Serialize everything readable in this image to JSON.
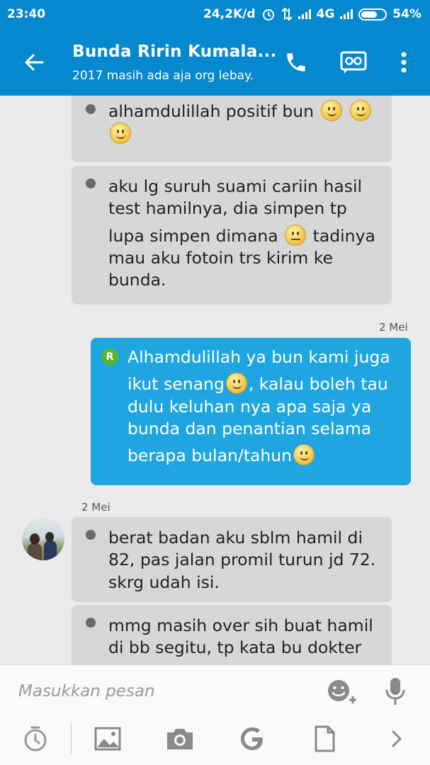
{
  "status_bar": {
    "time": "23:40",
    "speed": "24,2K/d",
    "network": "4G",
    "battery": "54%"
  },
  "header": {
    "title": "Bunda Ririn Kumala...",
    "subtitle": "2017 masih ada aja org lebay.",
    "icons": [
      "back-arrow-icon",
      "phone-icon",
      "video-call-icon",
      "more-vert-icon"
    ]
  },
  "messages": [
    {
      "direction": "in",
      "lines": [
        "alhamdulillah positif bun",
        ""
      ]
    },
    {
      "direction": "in",
      "lines": [
        "aku lg suruh suami cariin hasil",
        "test hamilnya, dia simpen tp",
        "lupa simpen dimana",
        "tadinya",
        "mau aku fotoin trs kirim ke",
        "bunda."
      ]
    },
    {
      "direction": "out",
      "date": "2 Mei",
      "badge": "R",
      "lines": [
        "Alhamdulillah ya bun kami juga",
        "ikut senang",
        ", kalau boleh tau",
        "dulu keluhan nya apa saja ya",
        "bunda dan penantian selama",
        "berapa bulan/tahun"
      ]
    },
    {
      "direction": "in",
      "date": "2 Mei",
      "lines": [
        "berat badan aku sblm hamil di",
        "82, pas jalan promil turun jd 72.",
        "skrg udah isi."
      ]
    },
    {
      "direction": "in",
      "lines": [
        "mmg masih over sih buat hamil",
        "di bb segitu, tp kata bu dokter"
      ]
    }
  ],
  "composer": {
    "placeholder": "Masukkan pesan",
    "tools": [
      "timer-icon",
      "image-icon",
      "camera-icon",
      "google-icon",
      "file-icon",
      "chevron-right-icon"
    ]
  },
  "colors": {
    "header_bg": "#0688cf",
    "outgoing_bubble": "#1fa6e0",
    "incoming_bubble": "#d7d7d7",
    "chat_bg": "#ebebeb"
  }
}
